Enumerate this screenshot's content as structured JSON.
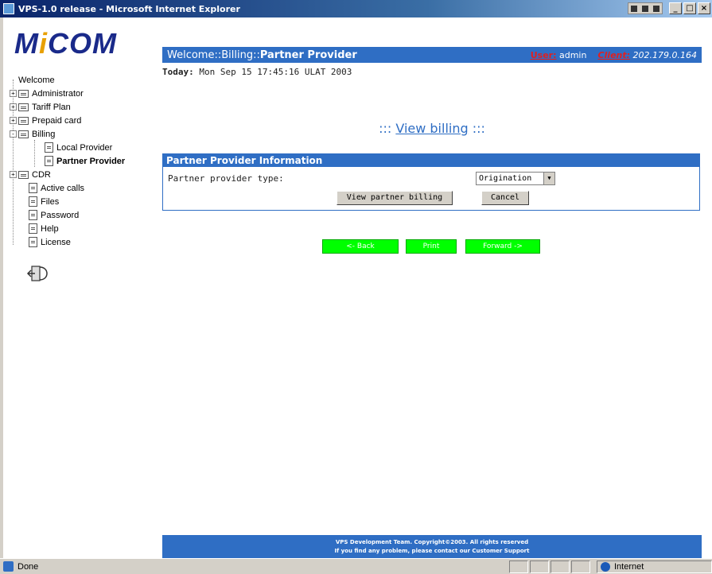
{
  "window": {
    "title": "VPS-1.0 release - Microsoft Internet Explorer",
    "minimize": "_",
    "maximize": "□",
    "close": "×"
  },
  "logo": {
    "text_pre": "M",
    "text_dot": "i",
    "text_post": "COM"
  },
  "sidebar": {
    "items": [
      {
        "label": "Welcome",
        "type": "root"
      },
      {
        "label": "Administrator",
        "type": "folder",
        "expander": "+"
      },
      {
        "label": "Tariff Plan",
        "type": "folder",
        "expander": "+"
      },
      {
        "label": "Prepaid card",
        "type": "folder",
        "expander": "+"
      },
      {
        "label": "Billing",
        "type": "folder",
        "expander": "-"
      },
      {
        "label": "Local Provider",
        "type": "doc",
        "child": true
      },
      {
        "label": "Partner Provider",
        "type": "doc",
        "child": true,
        "active": true
      },
      {
        "label": "CDR",
        "type": "folder",
        "expander": "+"
      },
      {
        "label": "Active calls",
        "type": "doc"
      },
      {
        "label": "Files",
        "type": "doc"
      },
      {
        "label": "Password",
        "type": "doc"
      },
      {
        "label": "Help",
        "type": "doc"
      },
      {
        "label": "License",
        "type": "doc"
      }
    ]
  },
  "header": {
    "crumb_prefix": "Welcome::Billing::",
    "crumb_current": "Partner Provider",
    "user_label": "User:",
    "user_value": " admin",
    "client_label": "Client:",
    "client_value": " 202.179.0.164"
  },
  "today": {
    "label": "Today:",
    "value": " Mon Sep 15 17:45:16 ULAT 2003"
  },
  "view_title": {
    "prefix": "::: ",
    "link": "View billing",
    "suffix": " :::"
  },
  "panel": {
    "heading": "Partner Provider Information",
    "field_label": "Partner provider type:",
    "select_value": "Origination",
    "view_button": "View partner billing",
    "cancel_button": "Cancel"
  },
  "nav": {
    "back": "<- Back",
    "print": "Print",
    "forward": "Forward ->"
  },
  "footer": {
    "line1": "VPS Development Team. Copyright©2003. All rights reserved",
    "line2": "If you find any problem, please contact our Customer Support"
  },
  "status": {
    "text": "Done",
    "zone": "Internet"
  }
}
